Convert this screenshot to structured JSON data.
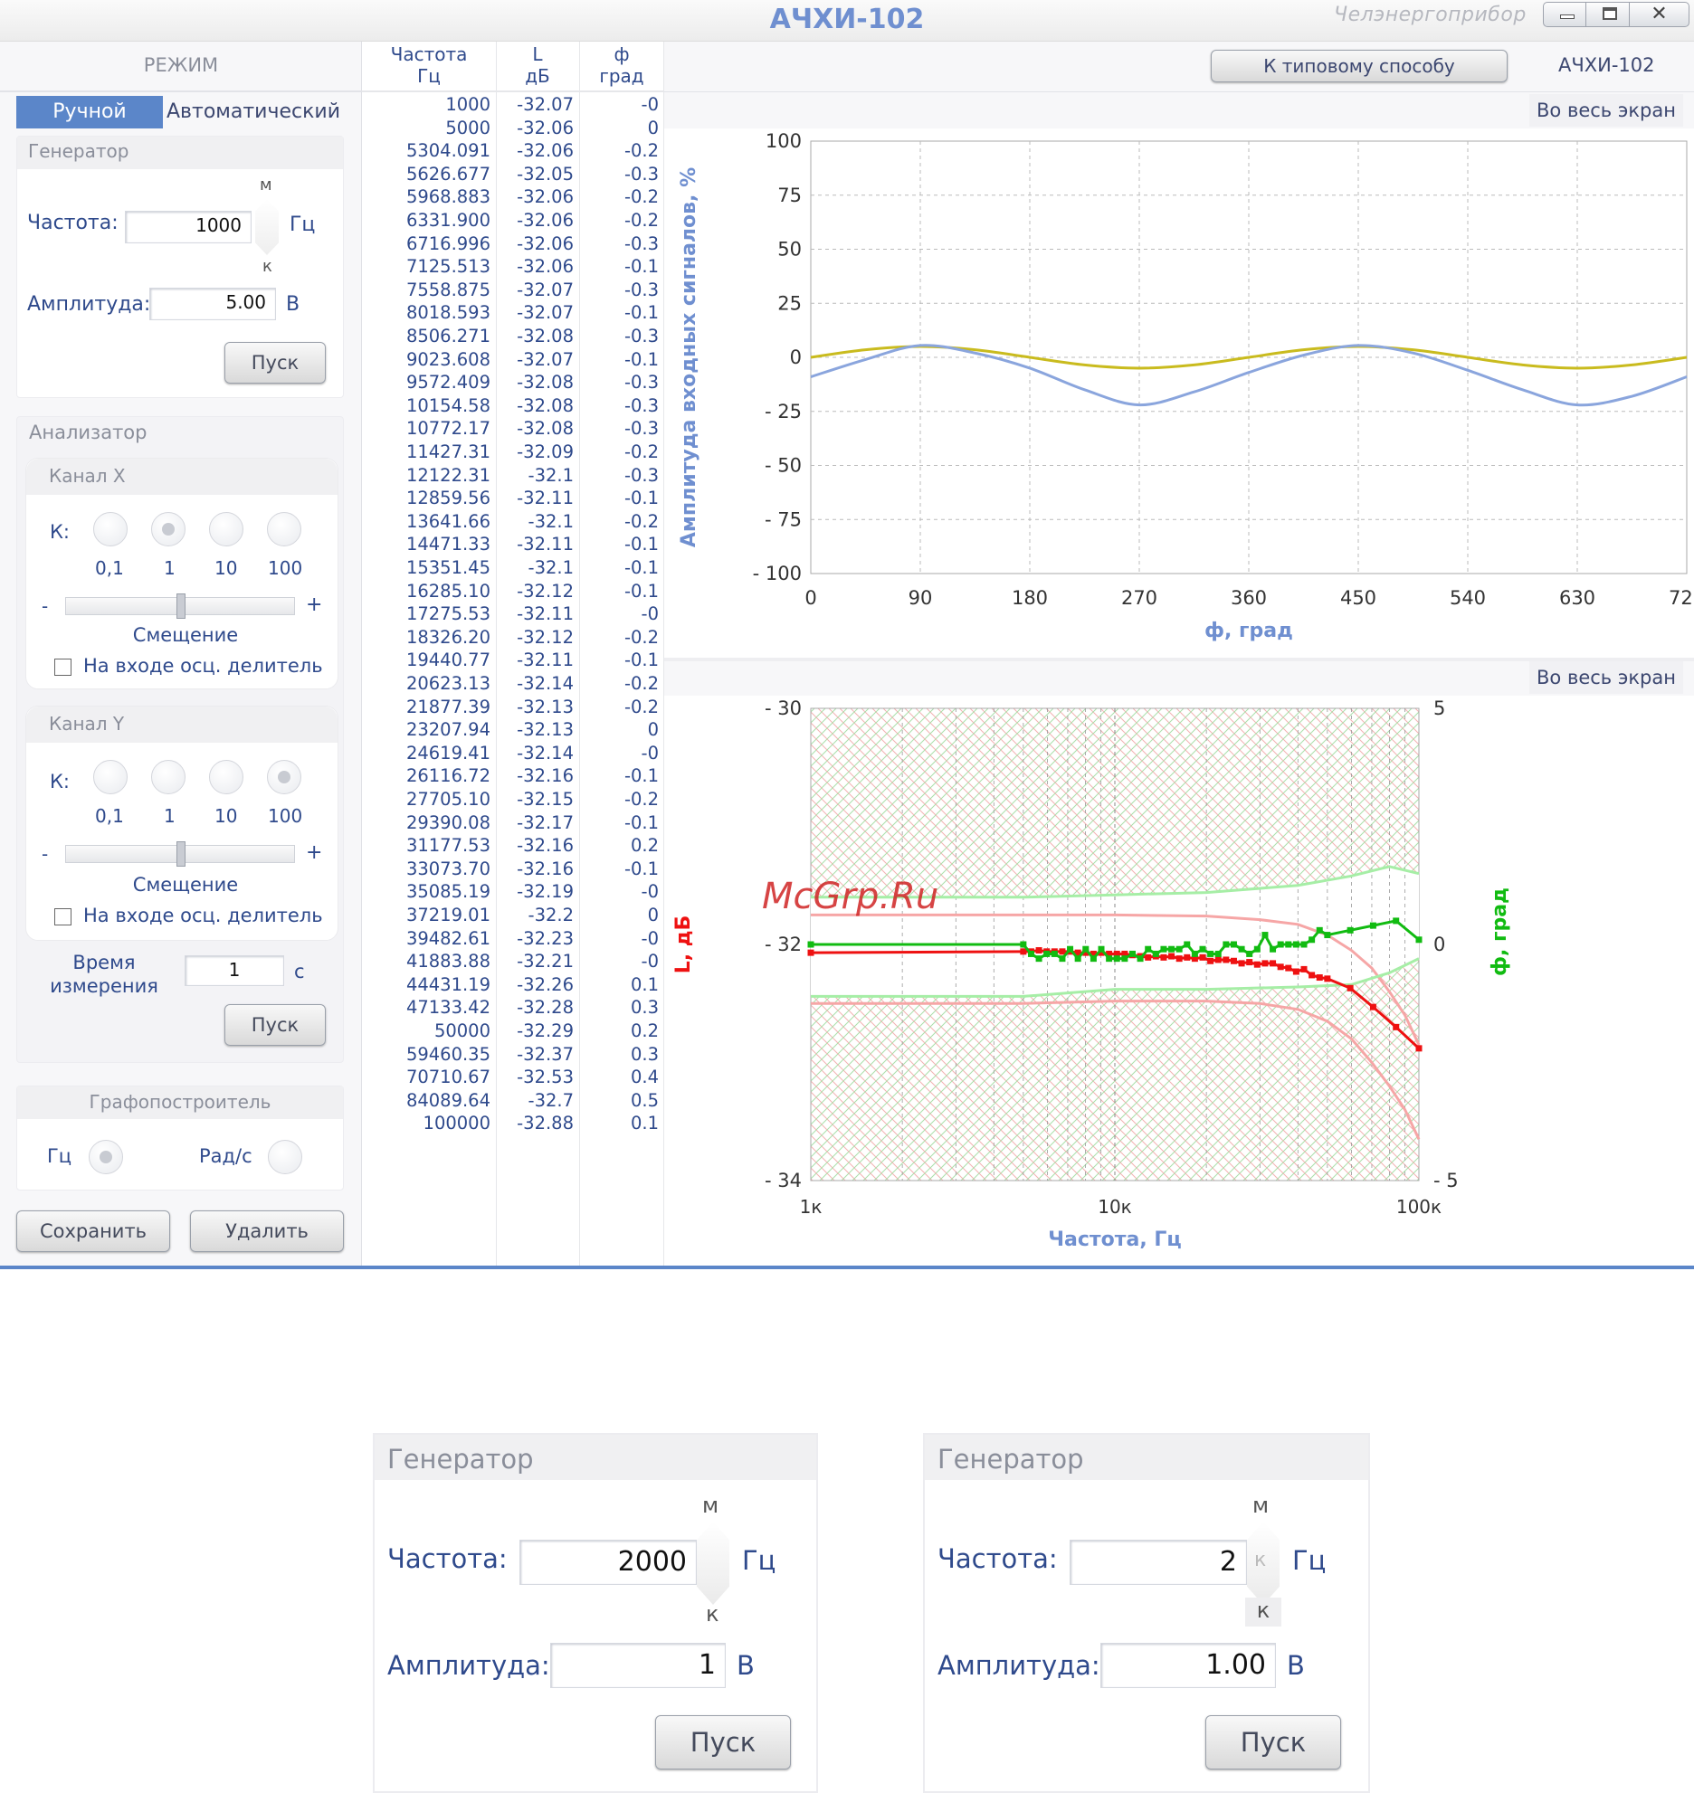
{
  "window": {
    "title": "АЧХИ-102",
    "brand": "Челэнергоприбор",
    "controls": {
      "minimize": "minimize-icon",
      "maximize": "maximize-icon",
      "close": "close-icon"
    }
  },
  "mode": {
    "heading": "РЕЖИМ",
    "tabs": [
      {
        "label": "Ручной",
        "active": true
      },
      {
        "label": "Автоматический",
        "active": false
      }
    ]
  },
  "generator": {
    "title": "Генератор",
    "freq_label": "Частота:",
    "freq_value": "1000",
    "freq_unit": "Гц",
    "spin_up": "м",
    "spin_down": "к",
    "amp_label": "Амплитуда:",
    "amp_value": "5.00",
    "amp_unit": "В",
    "start": "Пуск"
  },
  "analyzer": {
    "title": "Анализатор",
    "k_label": "К:",
    "k_options": [
      "0,1",
      "1",
      "10",
      "100"
    ],
    "channel_x": {
      "title": "Канал X",
      "selected": "1",
      "minus": "-",
      "plus": "+",
      "offset_label": "Смещение",
      "divider_label": "На входе осц. делитель"
    },
    "channel_y": {
      "title": "Канал Y",
      "selected": "100",
      "minus": "-",
      "plus": "+",
      "offset_label": "Смещение",
      "divider_label": "На входе осц. делитель"
    },
    "time_label_1": "Время",
    "time_label_2": "измерения",
    "time_value": "1",
    "time_unit": "с",
    "start": "Пуск"
  },
  "plotter": {
    "title": "Графопостроитель",
    "options": [
      "Гц",
      "Рад/с"
    ],
    "selected": "Гц"
  },
  "actions": {
    "save": "Сохранить",
    "delete": "Удалить"
  },
  "table": {
    "headers": [
      {
        "line1": "Частота",
        "line2": "Гц"
      },
      {
        "line1": "L",
        "line2": "дБ"
      },
      {
        "line1": "ф",
        "line2": "град"
      }
    ],
    "rows": [
      [
        "1000",
        "-32.07",
        "-0"
      ],
      [
        "5000",
        "-32.06",
        "0"
      ],
      [
        "5304.091",
        "-32.06",
        "-0.2"
      ],
      [
        "5626.677",
        "-32.05",
        "-0.3"
      ],
      [
        "5968.883",
        "-32.06",
        "-0.2"
      ],
      [
        "6331.900",
        "-32.06",
        "-0.2"
      ],
      [
        "6716.996",
        "-32.06",
        "-0.3"
      ],
      [
        "7125.513",
        "-32.06",
        "-0.1"
      ],
      [
        "7558.875",
        "-32.07",
        "-0.3"
      ],
      [
        "8018.593",
        "-32.07",
        "-0.1"
      ],
      [
        "8506.271",
        "-32.08",
        "-0.3"
      ],
      [
        "9023.608",
        "-32.07",
        "-0.1"
      ],
      [
        "9572.409",
        "-32.08",
        "-0.3"
      ],
      [
        "10154.58",
        "-32.08",
        "-0.3"
      ],
      [
        "10772.17",
        "-32.08",
        "-0.3"
      ],
      [
        "11427.31",
        "-32.09",
        "-0.2"
      ],
      [
        "12122.31",
        "-32.1",
        "-0.3"
      ],
      [
        "12859.56",
        "-32.11",
        "-0.1"
      ],
      [
        "13641.66",
        "-32.1",
        "-0.2"
      ],
      [
        "14471.33",
        "-32.11",
        "-0.1"
      ],
      [
        "15351.45",
        "-32.1",
        "-0.1"
      ],
      [
        "16285.10",
        "-32.12",
        "-0.1"
      ],
      [
        "17275.53",
        "-32.11",
        "-0"
      ],
      [
        "18326.20",
        "-32.12",
        "-0.2"
      ],
      [
        "19440.77",
        "-32.11",
        "-0.1"
      ],
      [
        "20623.13",
        "-32.14",
        "-0.2"
      ],
      [
        "21877.39",
        "-32.13",
        "-0.2"
      ],
      [
        "23207.94",
        "-32.13",
        "0"
      ],
      [
        "24619.41",
        "-32.14",
        "-0"
      ],
      [
        "26116.72",
        "-32.16",
        "-0.1"
      ],
      [
        "27705.10",
        "-32.15",
        "-0.2"
      ],
      [
        "29390.08",
        "-32.17",
        "-0.1"
      ],
      [
        "31177.53",
        "-32.16",
        "0.2"
      ],
      [
        "33073.70",
        "-32.16",
        "-0.1"
      ],
      [
        "35085.19",
        "-32.19",
        "-0"
      ],
      [
        "37219.01",
        "-32.2",
        "0"
      ],
      [
        "39482.61",
        "-32.23",
        "-0"
      ],
      [
        "41883.88",
        "-32.21",
        "-0"
      ],
      [
        "44431.19",
        "-32.26",
        "0.1"
      ],
      [
        "47133.42",
        "-32.28",
        "0.3"
      ],
      [
        "50000",
        "-32.29",
        "0.2"
      ],
      [
        "59460.35",
        "-32.37",
        "0.3"
      ],
      [
        "70710.67",
        "-32.53",
        "0.4"
      ],
      [
        "84089.64",
        "-32.7",
        "0.5"
      ],
      [
        "100000",
        "-32.88",
        "0.1"
      ]
    ]
  },
  "top_bar": {
    "typical_button": "К типовому способу",
    "device_label": "АЧХИ-102"
  },
  "fullscreen_label": "Во весь экран",
  "watermark": "McGrp.Ru",
  "colors": {
    "title": "#6f8fd0",
    "accent": "#5b86c9",
    "amp_trace": "#c9bb1e",
    "input_trace": "#8aa5dd",
    "L_series": "#ee1111",
    "phi_series": "#11bb11",
    "L_band": "#f6a6a6",
    "phi_band": "#a6eea6"
  },
  "chart_data": [
    {
      "type": "line",
      "title": "",
      "xlabel": "ф, град",
      "ylabel": "Амплитуда входных сигналов, %",
      "xlim": [
        0,
        720
      ],
      "ylim": [
        -100,
        100
      ],
      "xticks": [
        "0",
        "90",
        "180",
        "270",
        "360",
        "450",
        "540",
        "630",
        "720"
      ],
      "yticks": [
        "100",
        "75",
        "50",
        "25",
        "0",
        "- 25",
        "- 50",
        "- 75",
        "- 100"
      ],
      "grid": true,
      "series": [
        {
          "color": "#c9bb1e",
          "points": [
            [
              0,
              0
            ],
            [
              45,
              3.5
            ],
            [
              90,
              5
            ],
            [
              135,
              3.5
            ],
            [
              180,
              0
            ],
            [
              225,
              -3.5
            ],
            [
              270,
              -5
            ],
            [
              315,
              -3.5
            ],
            [
              360,
              0
            ],
            [
              405,
              3.5
            ],
            [
              450,
              5
            ],
            [
              495,
              3.5
            ],
            [
              540,
              0
            ],
            [
              585,
              -3.5
            ],
            [
              630,
              -5
            ],
            [
              675,
              -3.5
            ],
            [
              720,
              0
            ]
          ]
        },
        {
          "color": "#8aa5dd",
          "points": [
            [
              0,
              -9
            ],
            [
              45,
              -1
            ],
            [
              90,
              5.5
            ],
            [
              135,
              2
            ],
            [
              180,
              -5
            ],
            [
              225,
              -15
            ],
            [
              270,
              -22
            ],
            [
              315,
              -16
            ],
            [
              360,
              -7
            ],
            [
              405,
              1
            ],
            [
              450,
              5.5
            ],
            [
              495,
              2
            ],
            [
              540,
              -6
            ],
            [
              585,
              -15
            ],
            [
              630,
              -22
            ],
            [
              675,
              -18
            ],
            [
              720,
              -9
            ]
          ]
        }
      ]
    },
    {
      "type": "line",
      "title": "",
      "xlabel": "Частота, Гц",
      "ylabel": "L, дБ",
      "ylabel_right": "ф, град",
      "x_scale": "log",
      "xlim": [
        1000,
        100000
      ],
      "ylim": [
        -34,
        -30
      ],
      "y2lim": [
        -5,
        5
      ],
      "xticks": [
        "1к",
        "10к",
        "100к"
      ],
      "yticks": [
        "- 30",
        "- 32",
        "- 34"
      ],
      "y2ticks": [
        "5",
        "0",
        "- 5"
      ],
      "grid": true,
      "series": [
        {
          "axis": "left",
          "color": "#ee1111",
          "x": [
            1000,
            5000,
            5304.091,
            5626.677,
            5968.883,
            6331.9,
            6716.996,
            7125.513,
            7558.875,
            8018.593,
            8506.271,
            9023.608,
            9572.409,
            10154.58,
            10772.17,
            11427.31,
            12122.31,
            12859.56,
            13641.66,
            14471.33,
            15351.45,
            16285.1,
            17275.53,
            18326.2,
            19440.77,
            20623.13,
            21877.39,
            23207.94,
            24619.41,
            26116.72,
            27705.1,
            29390.08,
            31177.53,
            33073.7,
            35085.19,
            37219.01,
            39482.61,
            41883.88,
            44431.19,
            47133.42,
            50000,
            59460.35,
            70710.67,
            84089.64,
            100000
          ],
          "y": [
            -32.07,
            -32.06,
            -32.06,
            -32.05,
            -32.06,
            -32.06,
            -32.06,
            -32.06,
            -32.07,
            -32.07,
            -32.08,
            -32.07,
            -32.08,
            -32.08,
            -32.08,
            -32.09,
            -32.1,
            -32.11,
            -32.1,
            -32.11,
            -32.1,
            -32.12,
            -32.11,
            -32.12,
            -32.11,
            -32.14,
            -32.13,
            -32.13,
            -32.14,
            -32.16,
            -32.15,
            -32.17,
            -32.16,
            -32.16,
            -32.19,
            -32.2,
            -32.23,
            -32.21,
            -32.26,
            -32.28,
            -32.29,
            -32.37,
            -32.53,
            -32.7,
            -32.88
          ]
        },
        {
          "axis": "right",
          "color": "#11bb11",
          "x": [
            1000,
            5000,
            5304.091,
            5626.677,
            5968.883,
            6331.9,
            6716.996,
            7125.513,
            7558.875,
            8018.593,
            8506.271,
            9023.608,
            9572.409,
            10154.58,
            10772.17,
            11427.31,
            12122.31,
            12859.56,
            13641.66,
            14471.33,
            15351.45,
            16285.1,
            17275.53,
            18326.2,
            19440.77,
            20623.13,
            21877.39,
            23207.94,
            24619.41,
            26116.72,
            27705.1,
            29390.08,
            31177.53,
            33073.7,
            35085.19,
            37219.01,
            39482.61,
            41883.88,
            44431.19,
            47133.42,
            50000,
            59460.35,
            70710.67,
            84089.64,
            100000
          ],
          "y": [
            0,
            0,
            -0.2,
            -0.3,
            -0.2,
            -0.2,
            -0.3,
            -0.1,
            -0.3,
            -0.1,
            -0.3,
            -0.1,
            -0.3,
            -0.3,
            -0.3,
            -0.2,
            -0.3,
            -0.1,
            -0.2,
            -0.1,
            -0.1,
            -0.1,
            0,
            -0.2,
            -0.1,
            -0.2,
            -0.2,
            0,
            0,
            -0.1,
            -0.2,
            -0.1,
            0.2,
            -0.1,
            0,
            0,
            0,
            0,
            0.1,
            0.3,
            0.2,
            0.3,
            0.4,
            0.5,
            0.1
          ]
        },
        {
          "axis": "left",
          "color": "#f6a6a6",
          "x": [
            1000,
            5000,
            10000,
            20000,
            30000,
            40000,
            50000,
            60000,
            70000,
            80000,
            90000,
            100000
          ],
          "y": [
            -31.75,
            -31.75,
            -31.75,
            -31.76,
            -31.79,
            -31.83,
            -31.92,
            -32.05,
            -32.2,
            -32.4,
            -32.6,
            -32.85
          ]
        },
        {
          "axis": "left",
          "color": "#f6a6a6",
          "x": [
            1000,
            5000,
            10000,
            20000,
            30000,
            40000,
            50000,
            60000,
            70000,
            80000,
            90000,
            100000
          ],
          "y": [
            -32.5,
            -32.5,
            -32.48,
            -32.48,
            -32.5,
            -32.55,
            -32.65,
            -32.8,
            -33.0,
            -33.2,
            -33.4,
            -33.65
          ]
        },
        {
          "axis": "right",
          "color": "#a6eea6",
          "x": [
            1000,
            5000,
            10000,
            20000,
            40000,
            60000,
            80000,
            100000
          ],
          "y": [
            1.0,
            1.0,
            1.05,
            1.1,
            1.25,
            1.45,
            1.65,
            1.5
          ]
        },
        {
          "axis": "right",
          "color": "#a6eea6",
          "x": [
            1000,
            5000,
            10000,
            20000,
            40000,
            60000,
            80000,
            100000
          ],
          "y": [
            -1.1,
            -1.1,
            -0.95,
            -0.95,
            -0.9,
            -0.85,
            -0.6,
            -0.3
          ]
        }
      ]
    }
  ],
  "zoom_gen_1": {
    "title": "Генератор",
    "freq_label": "Частота:",
    "freq_value": "2000",
    "freq_unit": "Гц",
    "spin_up": "м",
    "spin_down": "к",
    "amp_label": "Амплитуда:",
    "amp_value": "1",
    "amp_unit": "В",
    "start": "Пуск"
  },
  "zoom_gen_2": {
    "title": "Генератор",
    "freq_label": "Частота:",
    "freq_value": "2",
    "freq_unit": "Гц",
    "spin_up": "м",
    "spin_mid": "к",
    "spin_down": "к",
    "amp_label": "Амплитуда:",
    "amp_value": "1.00",
    "amp_unit": "В",
    "start": "Пуск"
  }
}
